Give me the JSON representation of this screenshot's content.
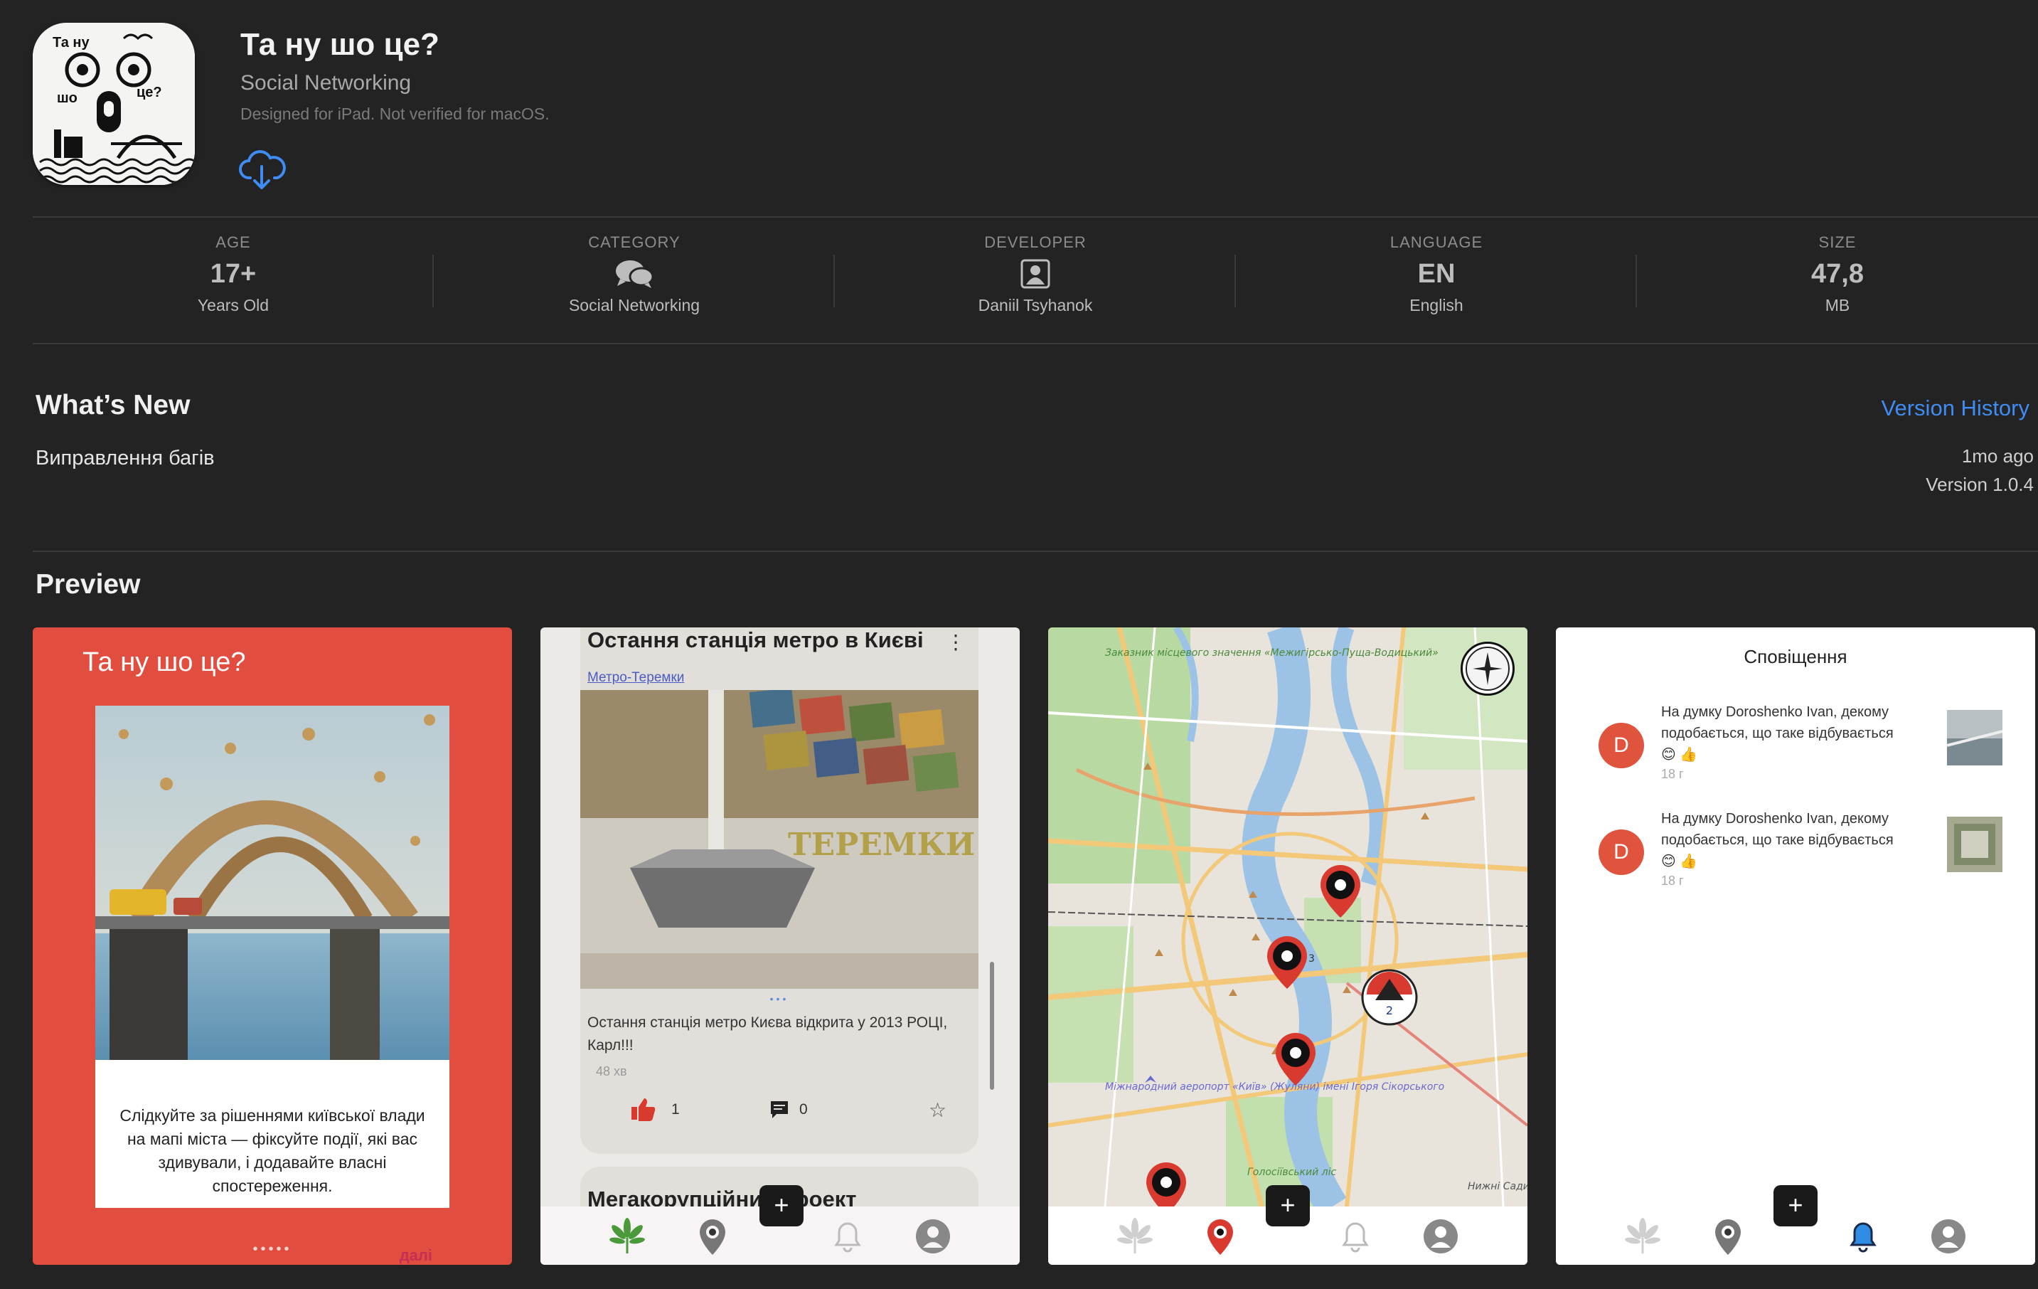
{
  "app": {
    "title": "Та ну шо це?",
    "category": "Social Networking",
    "note": "Designed for iPad. Not verified for macOS.",
    "icon_text": [
      "Та ну",
      "шо",
      "це?"
    ]
  },
  "info": [
    {
      "label": "AGE",
      "value": "17+",
      "sub": "Years Old"
    },
    {
      "label": "CATEGORY",
      "icon": "speech-bubbles-icon",
      "sub": "Social Networking"
    },
    {
      "label": "DEVELOPER",
      "icon": "person-icon",
      "sub": "Daniil Tsyhanok"
    },
    {
      "label": "LANGUAGE",
      "value": "EN",
      "sub": "English"
    },
    {
      "label": "SIZE",
      "value": "47,8",
      "sub": "MB"
    }
  ],
  "whats_new": {
    "title": "What’s New",
    "version_history": "Version History",
    "notes": "Виправлення багів",
    "ago": "1mo ago",
    "version": "Version 1.0.4"
  },
  "preview": {
    "title": "Preview",
    "shot1": {
      "title": "Та ну шо це?",
      "text": "Слідкуйте за рішеннями київської влади на мапі міста — фіксуйте події, які вас здивували, і додавайте власні спостереження.",
      "more": "далі",
      "dots": "•••••"
    },
    "shot2": {
      "post_title": "Остання станція метро в Києві",
      "tag": "Метро-Теремки",
      "sign": "ТЕРЕМКИ",
      "body": "Остання станція метро Києва відкрита у 2013 РОЦІ, Карл!!!",
      "time": "48 хв",
      "likes": "1",
      "comments": "0",
      "next_title": "Мегакорупційний проект",
      "menu": "⋮"
    },
    "shot3": {
      "cluster_count": "2",
      "marker_count": "3",
      "map_labels": [
        "Заказник місцевого значення «Межигірсько-Пуща-Водицький»",
        "Міжнародний аеропорт «Київ» (Жуляни) імені Ігоря Сікорського",
        "Голосіївський ліс",
        "Нижні Сади"
      ]
    },
    "shot4": {
      "title": "Сповіщення",
      "notifications": [
        {
          "initial": "D",
          "prefix": "На думку",
          "name": "Doroshenko Ivan,",
          "text": "декому подобається, що таке відбувається 😊 👍",
          "time": "18 г"
        },
        {
          "initial": "D",
          "prefix": "На думку",
          "name": "Doroshenko Ivan,",
          "text": "декому подобається, що таке відбувається 😊 👍",
          "time": "18 г"
        }
      ]
    },
    "fab": "+"
  },
  "colors": {
    "accent": "#3f8cf5",
    "preview_red": "#e14d3f",
    "marker_red": "#d93a2f"
  }
}
